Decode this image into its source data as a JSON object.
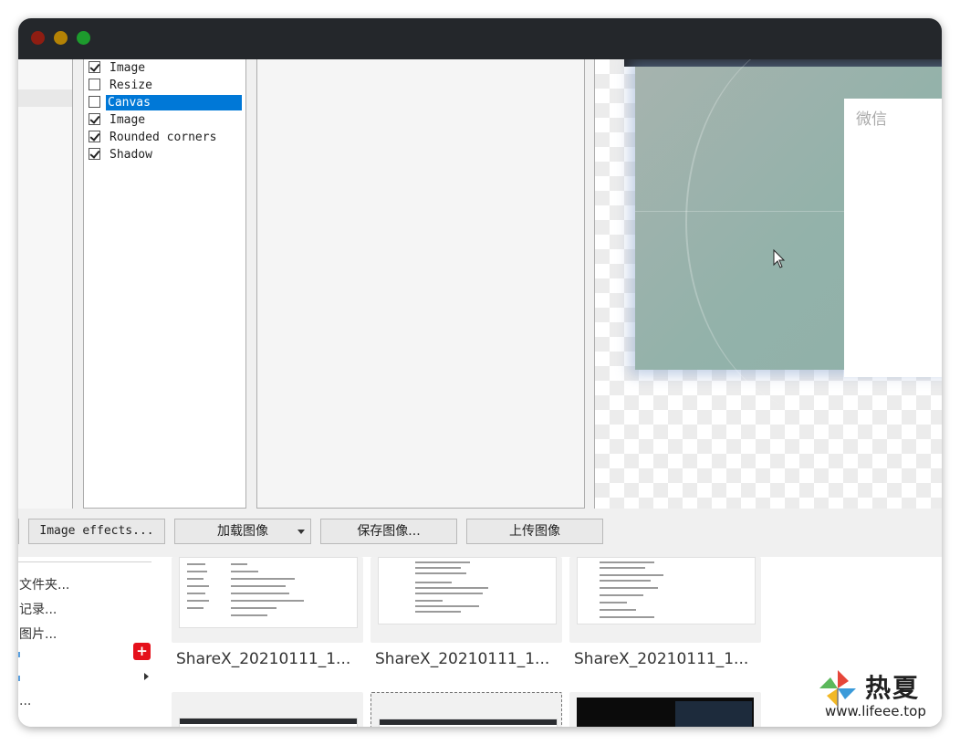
{
  "window": {
    "traffic_lights": [
      "close",
      "minimize",
      "zoom"
    ]
  },
  "effects_list": {
    "items": [
      {
        "label": "Image",
        "checked": true,
        "selected": false
      },
      {
        "label": "Resize",
        "checked": false,
        "selected": false
      },
      {
        "label": "Canvas",
        "checked": false,
        "selected": true
      },
      {
        "label": "Image",
        "checked": true,
        "selected": false
      },
      {
        "label": "Rounded corners",
        "checked": true,
        "selected": false
      },
      {
        "label": "Shadow",
        "checked": true,
        "selected": false
      }
    ]
  },
  "preview": {
    "card_title": "微信"
  },
  "toolbar": {
    "image_effects_label": "Image effects...",
    "load_image_label": "加载图像",
    "save_image_label": "保存图像...",
    "upload_image_label": "上传图像"
  },
  "explorer": {
    "sidebar_items": [
      "文件夹...",
      "记录...",
      "图片...",
      "..."
    ],
    "captions": [
      "ShareX_20210111_1...",
      "ShareX_20210111_1...",
      "ShareX_20210111_1..."
    ]
  },
  "watermark": {
    "title": "热夏",
    "url": "www.lifeee.top"
  },
  "colors": {
    "titlebar": "#24272b",
    "selection": "#0078d7",
    "close": "#8e1d12",
    "minimize": "#b48205",
    "zoom": "#1d9b2d",
    "badge": "#e5101b"
  }
}
